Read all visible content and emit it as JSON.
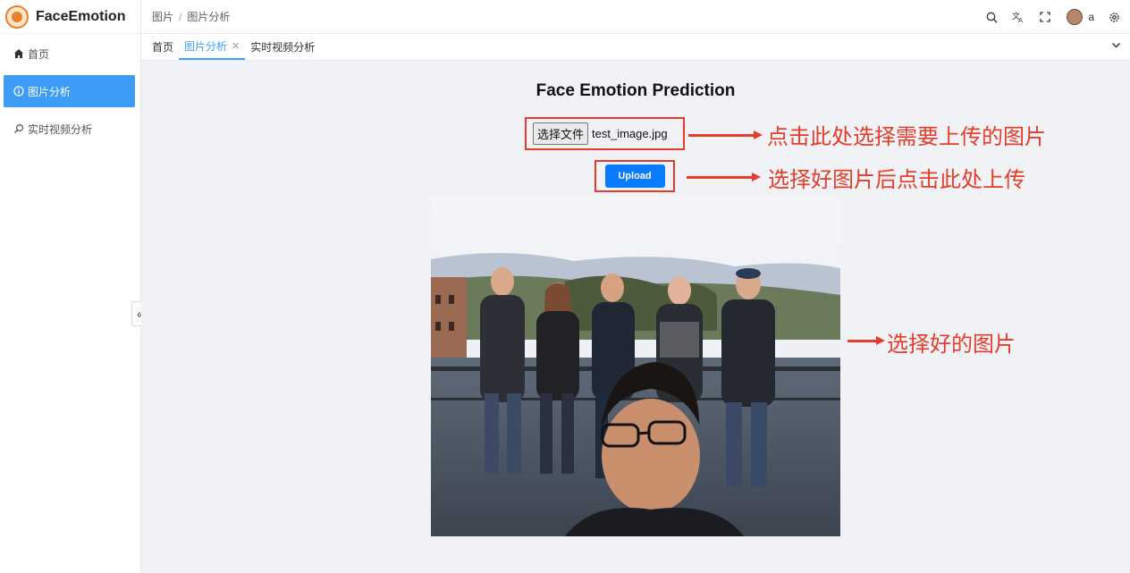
{
  "app": {
    "title": "FaceEmotion"
  },
  "sidebar": {
    "items": [
      {
        "label": "首页",
        "icon": "home-icon",
        "active": false
      },
      {
        "label": "图片分析",
        "icon": "info-icon",
        "active": true
      },
      {
        "label": "实时视频分析",
        "icon": "search-icon",
        "active": false
      }
    ],
    "collapse_label": "«"
  },
  "header": {
    "breadcrumb": [
      "图片",
      "图片分析"
    ],
    "separator": "/",
    "icons": [
      "search-icon",
      "translate-icon",
      "fullscreen-icon",
      "avatar",
      "settings-icon"
    ],
    "username": "a"
  },
  "tabs": [
    {
      "label": "首页",
      "active": false
    },
    {
      "label": "图片分析",
      "active": true,
      "closable": true
    },
    {
      "label": "实时视频分析",
      "active": false
    }
  ],
  "main": {
    "title": "Face Emotion Prediction",
    "file_button": "选择文件",
    "file_name": "test_image.jpg",
    "upload_label": "Upload",
    "annotations": {
      "choose": "点击此处选择需要上传的图片",
      "upload": "选择好图片后点击此处上传",
      "image": "选择好的图片"
    }
  },
  "colors": {
    "accent": "#3d9cf5",
    "annotation": "#e53d2a",
    "upload_button": "#0a7cff"
  }
}
